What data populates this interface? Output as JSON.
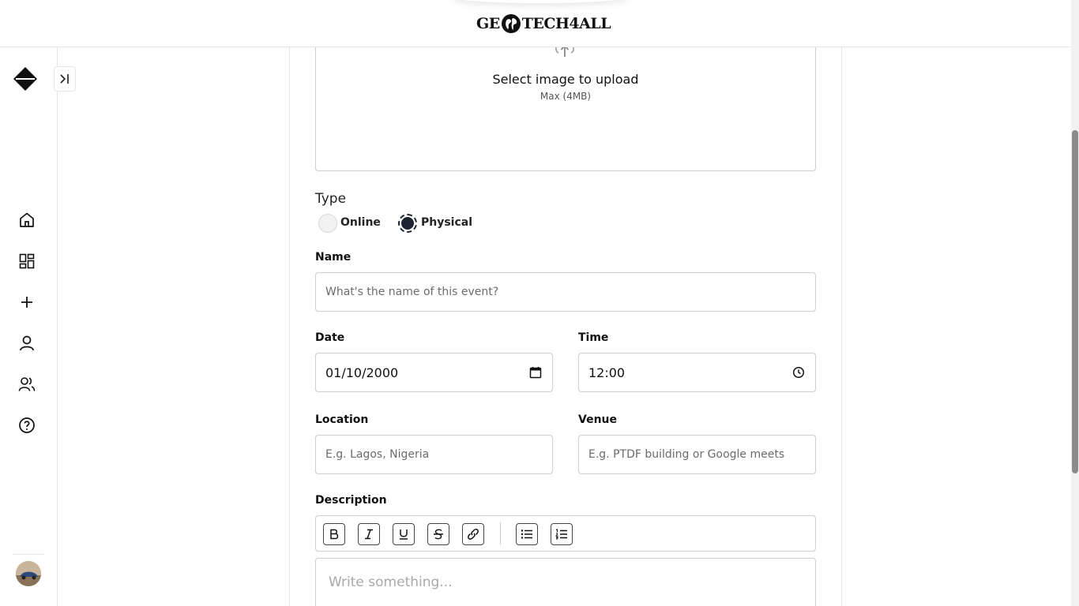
{
  "header": {
    "logo_left": "GE",
    "logo_right": "TECH4ALL"
  },
  "sidebar": {
    "nav": [
      {
        "icon": "home-icon"
      },
      {
        "icon": "dashboard-icon"
      },
      {
        "icon": "plus-icon"
      },
      {
        "icon": "user-icon"
      },
      {
        "icon": "users-icon"
      },
      {
        "icon": "help-icon"
      }
    ]
  },
  "upload": {
    "title": "Select image to upload",
    "subtitle": "Max (4MB)"
  },
  "form": {
    "type_label": "Type",
    "type_options": [
      "Online",
      "Physical"
    ],
    "type_selected": "Physical",
    "name_label": "Name",
    "name_placeholder": "What's the name of this event?",
    "date_label": "Date",
    "date_value": "01/10/2000",
    "time_label": "Time",
    "time_value": "12:00",
    "location_label": "Location",
    "location_placeholder": "E.g. Lagos, Nigeria",
    "venue_label": "Venue",
    "venue_placeholder": "E.g. PTDF building or Google meets",
    "description_label": "Description",
    "description_placeholder": "Write something..."
  },
  "toolbar": {
    "buttons": [
      "bold-icon",
      "italic-icon",
      "underline-icon",
      "strikethrough-icon",
      "link-icon",
      "bullet-list-icon",
      "numbered-list-icon"
    ]
  },
  "colors": {
    "accent": "#1d2330",
    "border": "#cfcfcf"
  }
}
